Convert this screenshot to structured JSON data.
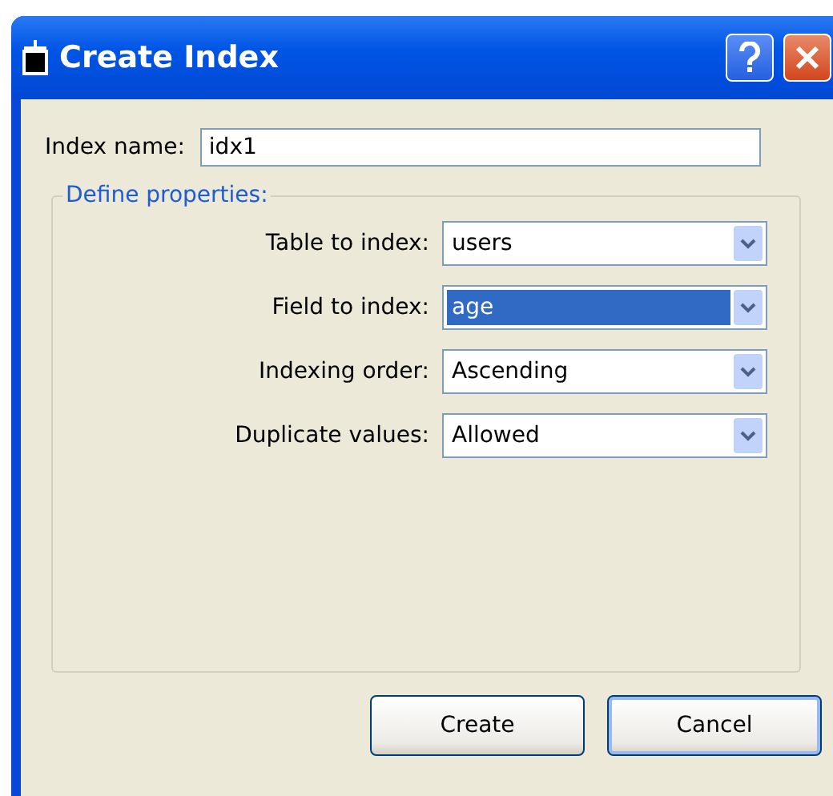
{
  "window": {
    "title": "Create Index"
  },
  "index_name": {
    "label": "Index name:",
    "value": "idx1"
  },
  "group": {
    "title": "Define properties:",
    "fields": [
      {
        "label": "Table to index:",
        "value": "users",
        "selected": false
      },
      {
        "label": "Field to index:",
        "value": "age",
        "selected": true
      },
      {
        "label": "Indexing order:",
        "value": "Ascending",
        "selected": false
      },
      {
        "label": "Duplicate values:",
        "value": "Allowed",
        "selected": false
      }
    ]
  },
  "buttons": [
    {
      "label": "Create",
      "focused": false
    },
    {
      "label": "Cancel",
      "focused": true
    }
  ]
}
